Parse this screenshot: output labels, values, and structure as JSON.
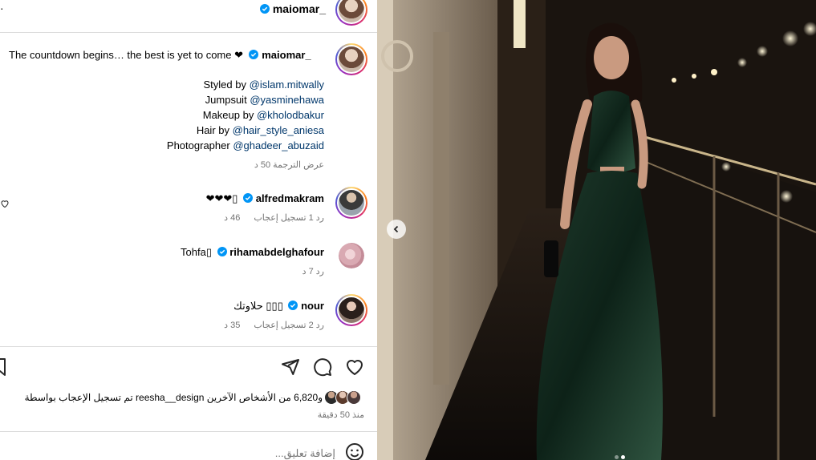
{
  "header": {
    "username": "maiomar_",
    "more_icon": "more-icon"
  },
  "caption": {
    "username": "maiomar_",
    "text": "The countdown begins… the best is yet to come ❤",
    "credits": [
      {
        "label": "Styled by",
        "handle": "@islam.mitwally"
      },
      {
        "label": "Jumpsuit",
        "handle": "@yasminehawa"
      },
      {
        "label": "Makeup by",
        "handle": "@kholodbakur"
      },
      {
        "label": "Hair by",
        "handle": "@hair_style_aniesa"
      },
      {
        "label": "Photographer",
        "handle": "@ghadeer_abuzaid"
      }
    ],
    "time": "50 د",
    "see_translation": "عرض الترجمة"
  },
  "comments": [
    {
      "username": "alfredmakram",
      "text": "❤❤❤▯",
      "time": "46 د",
      "likes": "1 تسجيل إعجاب",
      "reply": "رد",
      "story": true
    },
    {
      "username": "rihamabdelghafour",
      "text": "Tohfa▯",
      "time": "7 د",
      "likes": "",
      "reply": "رد",
      "story": false
    },
    {
      "username": "nour",
      "text": "حلاوتك ▯▯▯",
      "time": "35 د",
      "likes": "2 تسجيل إعجاب",
      "reply": "رد",
      "story": true
    }
  ],
  "likes_text": "تم تسجيل الإعجاب بواسطة reesha__design و6,820 من الأشخاص الآخرين",
  "post_time": "منذ 50 دقيقة",
  "comment_box": {
    "placeholder": "إضافة تعليق..."
  },
  "colors": {
    "link": "#00376b",
    "verified": "#0095f6",
    "muted": "#737373",
    "divider": "#dbdbdb"
  },
  "icons": [
    "heart-icon",
    "comment-icon",
    "share-icon",
    "bookmark-icon",
    "emoji-icon",
    "chevron-left-icon",
    "verified-icon"
  ]
}
